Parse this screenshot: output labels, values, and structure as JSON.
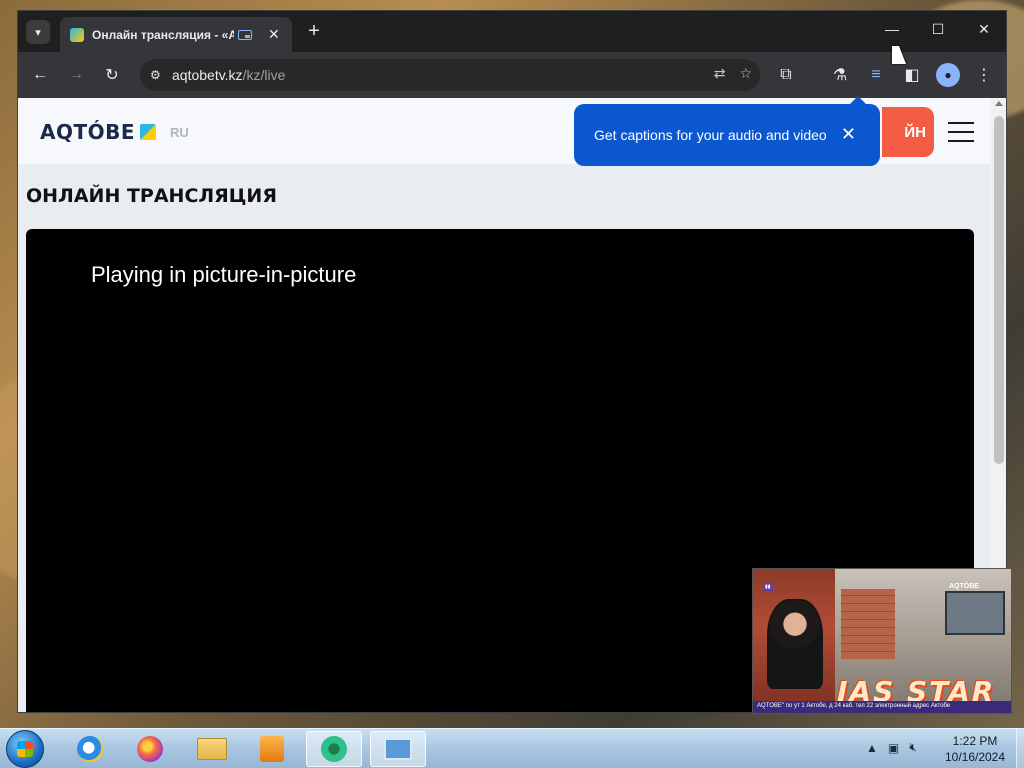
{
  "browser": {
    "tab": {
      "title": "Онлайн трансляция - «АQ",
      "close": "✕"
    },
    "new_tab": "+",
    "window_controls": {
      "minimize": "—",
      "maximize": "☐",
      "close": "✕"
    },
    "url_host": "aqtobetv.kz",
    "url_path": "/kz/live"
  },
  "site": {
    "logo": "AQTÓBE",
    "lang": "RU",
    "online_button_partial": "ЙН",
    "heading": "ОНЛАЙН ТРАНСЛЯЦИЯ",
    "player_message": "Playing in picture-in-picture"
  },
  "captions_bubble": {
    "text": "Get captions for your audio and video",
    "close": "✕"
  },
  "pip": {
    "channel_logo": "AQTÓBE",
    "show_title": "JAS STAR",
    "ticker": "AQTOBE\" по ут 1 Актобе, д 24 каб. тел 22 электронный адрес Актобе"
  },
  "taskbar": {
    "clock_time": "1:22 PM",
    "clock_date": "10/16/2024",
    "tray_expand": "▲"
  },
  "colors": {
    "accent_blue": "#0b57d0",
    "online_red": "#f25c43",
    "brand_navy": "#1b2a4a"
  }
}
